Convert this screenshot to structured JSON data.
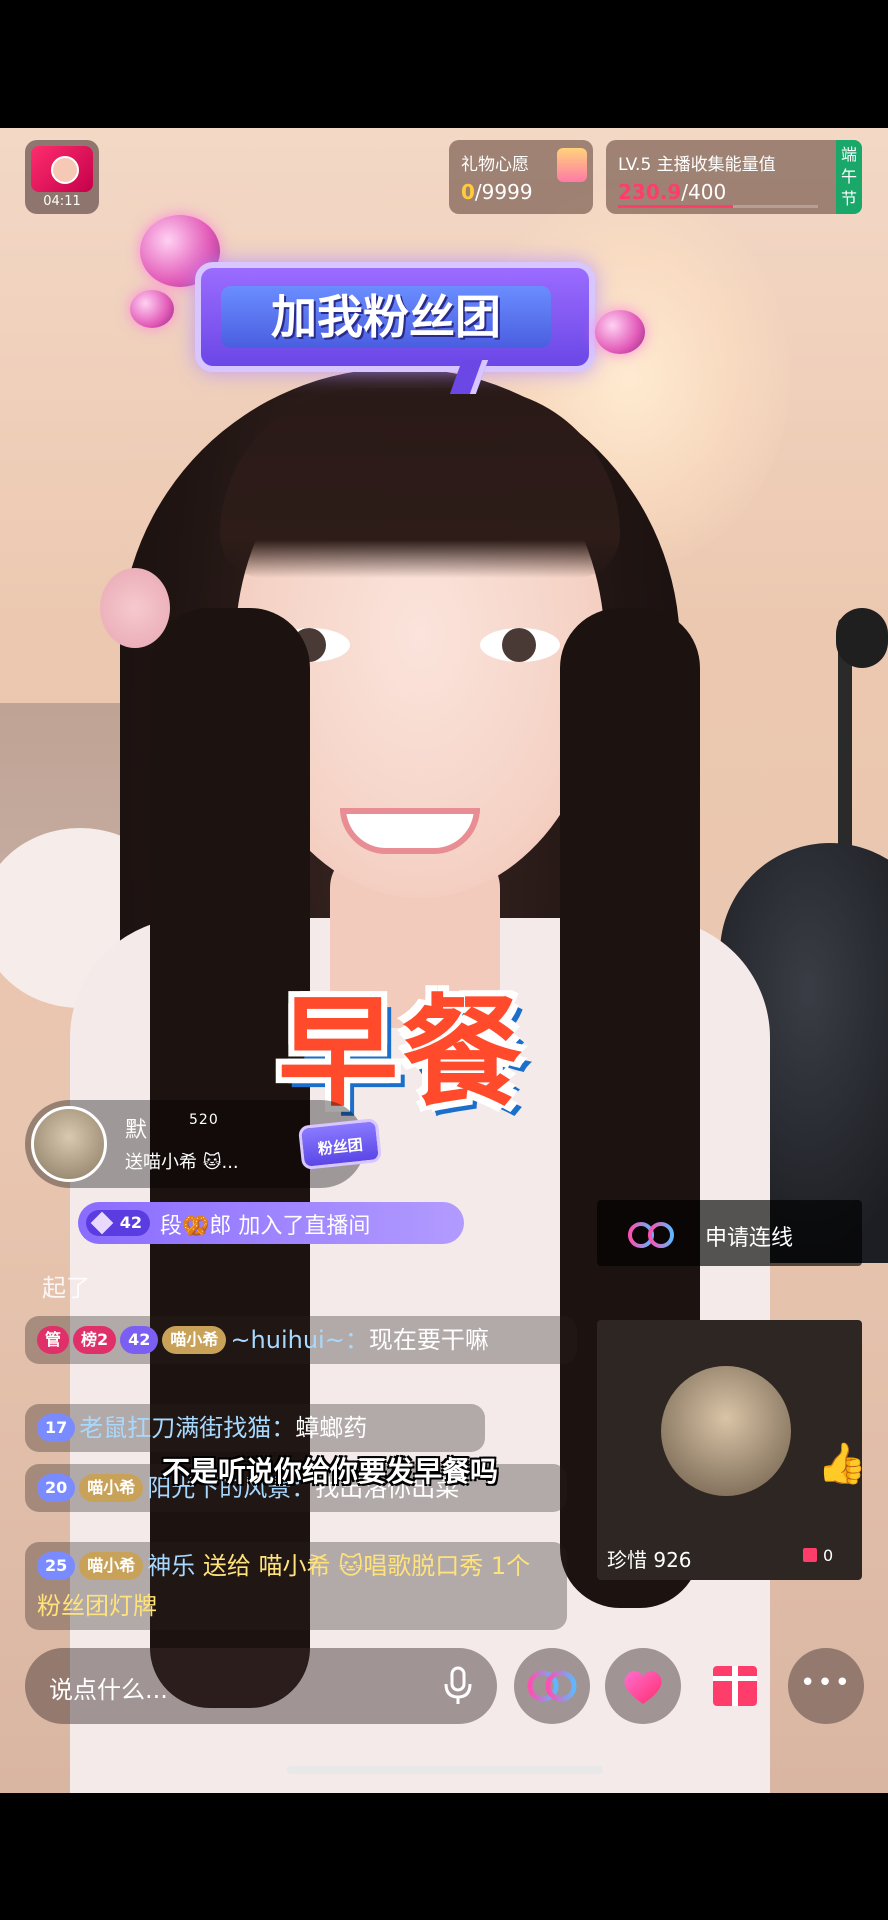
{
  "stream": {
    "elapsed": "04:11"
  },
  "wish": {
    "title": "礼物心愿",
    "current": "0",
    "total": "/9999"
  },
  "energy": {
    "level": "LV.5",
    "label": "主播收集能量值",
    "current": "230.9",
    "total": "/400",
    "progress": 0.577
  },
  "festival": {
    "label": "端午节"
  },
  "sticker": {
    "text": "加我粉丝团"
  },
  "big_caption": "早餐",
  "gift_notice": {
    "name": "默",
    "level": "520",
    "action": "送喵小希 🐱...",
    "item": "粉丝团"
  },
  "join": {
    "level": "42",
    "message": "段🥨郎 加入了直播间"
  },
  "faded_msg": "起了",
  "chat": {
    "m1": {
      "badge_admin": "管",
      "badge_rank": "榜2",
      "badge_fan": "42",
      "badge_club": "喵小希",
      "user": "~huihui~：",
      "text": "现在要干嘛"
    },
    "m2": {
      "badge_lv": "17",
      "user": "老鼠扛刀满街找猫：",
      "text": "蟑螂药"
    },
    "m3": {
      "badge_lv": "20",
      "badge_club": "喵小希",
      "user": "阳光下的风景：",
      "text": "找出洛你出菜"
    },
    "m4": {
      "badge_lv": "25",
      "badge_club": "喵小希",
      "user": "神乐",
      "g1": "送给",
      "g2": "喵小希 🐱",
      "text": "唱歌脱口秀 1个 粉丝团灯牌"
    }
  },
  "subtitle": "不是听说你给你要发早餐吗",
  "link": {
    "apply": "申请连线"
  },
  "cohost": {
    "name": "珍惜 926",
    "gifts": "0"
  },
  "input": {
    "placeholder": "说点什么..."
  },
  "more": {
    "dots": "•••"
  },
  "colors": {
    "accent": "#ff3d6a",
    "gold": "#ffcb3b",
    "festival": "#1aa86a",
    "fan_purple": "#7a5ff2"
  },
  "icons": [
    "mic-icon",
    "link-icon",
    "heart-icon",
    "gift-icon",
    "more-icon"
  ]
}
